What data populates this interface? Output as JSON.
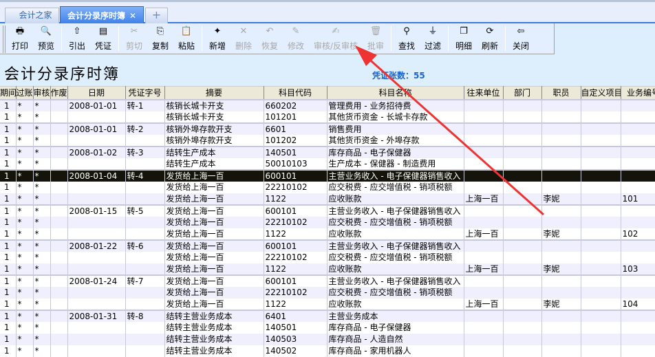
{
  "tabs": [
    {
      "label": "会计之家",
      "active": false
    },
    {
      "label": "会计分录序时簿",
      "active": true,
      "close": "✕"
    },
    {
      "label": "+",
      "active": false
    }
  ],
  "toolbar": {
    "groups": [
      [
        {
          "id": "print",
          "label": "打印",
          "icon": "printer-icon",
          "glyph": "🖶",
          "enabled": true
        },
        {
          "id": "preview",
          "label": "预览",
          "icon": "preview-icon",
          "glyph": "🔍",
          "enabled": true
        }
      ],
      [
        {
          "id": "export",
          "label": "引出",
          "icon": "export-icon",
          "glyph": "⇧",
          "enabled": true
        },
        {
          "id": "voucher",
          "label": "凭证",
          "icon": "voucher-icon",
          "glyph": "▤",
          "enabled": true
        }
      ],
      [
        {
          "id": "cut",
          "label": "剪切",
          "icon": "scissors-icon",
          "glyph": "✂",
          "enabled": false
        },
        {
          "id": "copy",
          "label": "复制",
          "icon": "copy-icon",
          "glyph": "⎘",
          "enabled": true
        },
        {
          "id": "paste",
          "label": "粘贴",
          "icon": "paste-icon",
          "glyph": "📋",
          "enabled": true
        }
      ],
      [
        {
          "id": "new",
          "label": "新增",
          "icon": "new-icon",
          "glyph": "✦",
          "enabled": true
        },
        {
          "id": "delete",
          "label": "删除",
          "icon": "delete-icon",
          "glyph": "✕",
          "enabled": false
        },
        {
          "id": "restore",
          "label": "恢复",
          "icon": "undo-icon",
          "glyph": "↶",
          "enabled": false
        },
        {
          "id": "modify",
          "label": "修改",
          "icon": "edit-icon",
          "glyph": "✎",
          "enabled": false
        },
        {
          "id": "audit",
          "label": "审核/反审核",
          "icon": "audit-icon",
          "glyph": "✍",
          "enabled": false
        },
        {
          "id": "approve",
          "label": "批审",
          "icon": "trash-icon",
          "glyph": "🗑",
          "enabled": false
        }
      ],
      [
        {
          "id": "find",
          "label": "查找",
          "icon": "binoculars-icon",
          "glyph": "⚲",
          "enabled": true
        },
        {
          "id": "filter",
          "label": "过滤",
          "icon": "filter-icon",
          "glyph": "⏚",
          "enabled": true
        }
      ],
      [
        {
          "id": "detail",
          "label": "明细",
          "icon": "detail-icon",
          "glyph": "❐",
          "enabled": true
        },
        {
          "id": "refresh",
          "label": "刷新",
          "icon": "refresh-icon",
          "glyph": "⟳",
          "enabled": true
        }
      ],
      [
        {
          "id": "close",
          "label": "关闭",
          "icon": "exit-door-icon",
          "glyph": "⇦",
          "enabled": true
        }
      ]
    ]
  },
  "page": {
    "title": "会计分录序时簿",
    "count_label": "凭证张数：",
    "count_value": "55"
  },
  "table": {
    "columns": [
      "期间",
      "过账",
      "审核",
      "作废",
      "日期",
      "凭证字号",
      "摘要",
      "科目代码",
      "科目名称",
      "往来单位",
      "部门",
      "职员",
      "自定义项目",
      "业务编号"
    ],
    "rows": [
      {
        "period": "1",
        "posted": "*",
        "audited": "*",
        "voided": "",
        "date": "2008-01-01",
        "voucher": "转-1",
        "summary": "核销长城卡开支",
        "code": "660202",
        "account": "管理费用 - 业务招待费",
        "partner": "",
        "dept": "",
        "staff": "",
        "custom": "",
        "bizno": "",
        "group_start": true
      },
      {
        "period": "1",
        "posted": "*",
        "audited": "*",
        "voided": "",
        "date": "",
        "voucher": "",
        "summary": "核销长城卡开支",
        "code": "101201",
        "account": "其他货币资金 - 长城卡存款",
        "partner": "",
        "dept": "",
        "staff": "",
        "custom": "",
        "bizno": ""
      },
      {
        "period": "1",
        "posted": "*",
        "audited": "*",
        "voided": "",
        "date": "2008-01-01",
        "voucher": "转-2",
        "summary": "核销外埠存款开支",
        "code": "6601",
        "account": "销售费用",
        "partner": "",
        "dept": "",
        "staff": "",
        "custom": "",
        "bizno": "",
        "group_start": true
      },
      {
        "period": "1",
        "posted": "*",
        "audited": "*",
        "voided": "",
        "date": "",
        "voucher": "",
        "summary": "核销外埠存款开支",
        "code": "101202",
        "account": "其他货币资金 - 外埠存款",
        "partner": "",
        "dept": "",
        "staff": "",
        "custom": "",
        "bizno": ""
      },
      {
        "period": "1",
        "posted": "*",
        "audited": "*",
        "voided": "",
        "date": "2008-01-02",
        "voucher": "转-3",
        "summary": "结转生产成本",
        "code": "140501",
        "account": "库存商品 - 电子保健器",
        "partner": "",
        "dept": "",
        "staff": "",
        "custom": "",
        "bizno": "",
        "group_start": true
      },
      {
        "period": "1",
        "posted": "*",
        "audited": "*",
        "voided": "",
        "date": "",
        "voucher": "",
        "summary": "结转生产成本",
        "code": "50010103",
        "account": "生产成本 - 保健器 - 制造费用",
        "partner": "",
        "dept": "",
        "staff": "",
        "custom": "",
        "bizno": ""
      },
      {
        "period": "1",
        "posted": "*",
        "audited": "*",
        "voided": "",
        "date": "2008-01-04",
        "voucher": "转-4",
        "summary": "发货给上海一百",
        "code": "600101",
        "account": "主营业务收入 - 电子保健器销售收入",
        "partner": "",
        "dept": "",
        "staff": "",
        "custom": "",
        "bizno": "",
        "group_start": true,
        "selected": true
      },
      {
        "period": "1",
        "posted": "*",
        "audited": "*",
        "voided": "",
        "date": "",
        "voucher": "",
        "summary": "发货给上海一百",
        "code": "22210102",
        "account": "应交税费 - 应交增值税 - 销项税额",
        "partner": "",
        "dept": "",
        "staff": "",
        "custom": "",
        "bizno": ""
      },
      {
        "period": "1",
        "posted": "*",
        "audited": "*",
        "voided": "",
        "date": "",
        "voucher": "",
        "summary": "发货给上海一百",
        "code": "1122",
        "account": "应收账款",
        "partner": "上海一百",
        "dept": "",
        "staff": "李妮",
        "custom": "",
        "bizno": "101"
      },
      {
        "period": "1",
        "posted": "*",
        "audited": "*",
        "voided": "",
        "date": "2008-01-15",
        "voucher": "转-5",
        "summary": "发货给上海一百",
        "code": "600101",
        "account": "主营业务收入 - 电子保健器销售收入",
        "partner": "",
        "dept": "",
        "staff": "",
        "custom": "",
        "bizno": "",
        "group_start": true
      },
      {
        "period": "1",
        "posted": "*",
        "audited": "*",
        "voided": "",
        "date": "",
        "voucher": "",
        "summary": "发货给上海一百",
        "code": "22210102",
        "account": "应交税费 - 应交增值税 - 销项税额",
        "partner": "",
        "dept": "",
        "staff": "",
        "custom": "",
        "bizno": ""
      },
      {
        "period": "1",
        "posted": "*",
        "audited": "*",
        "voided": "",
        "date": "",
        "voucher": "",
        "summary": "发货给上海一百",
        "code": "1122",
        "account": "应收账款",
        "partner": "上海一百",
        "dept": "",
        "staff": "李妮",
        "custom": "",
        "bizno": "102"
      },
      {
        "period": "1",
        "posted": "*",
        "audited": "*",
        "voided": "",
        "date": "2008-01-22",
        "voucher": "转-6",
        "summary": "发货给上海一百",
        "code": "600101",
        "account": "主营业务收入 - 电子保健器销售收入",
        "partner": "",
        "dept": "",
        "staff": "",
        "custom": "",
        "bizno": "",
        "group_start": true
      },
      {
        "period": "1",
        "posted": "*",
        "audited": "*",
        "voided": "",
        "date": "",
        "voucher": "",
        "summary": "发货给上海一百",
        "code": "22210102",
        "account": "应交税费 - 应交增值税 - 销项税额",
        "partner": "",
        "dept": "",
        "staff": "",
        "custom": "",
        "bizno": ""
      },
      {
        "period": "1",
        "posted": "*",
        "audited": "*",
        "voided": "",
        "date": "",
        "voucher": "",
        "summary": "发货给上海一百",
        "code": "1122",
        "account": "应收账款",
        "partner": "上海一百",
        "dept": "",
        "staff": "李妮",
        "custom": "",
        "bizno": "103"
      },
      {
        "period": "1",
        "posted": "*",
        "audited": "*",
        "voided": "",
        "date": "2008-01-24",
        "voucher": "转-7",
        "summary": "发货给上海一百",
        "code": "600101",
        "account": "主营业务收入 - 电子保健器销售收入",
        "partner": "",
        "dept": "",
        "staff": "",
        "custom": "",
        "bizno": "",
        "group_start": true
      },
      {
        "period": "1",
        "posted": "*",
        "audited": "*",
        "voided": "",
        "date": "",
        "voucher": "",
        "summary": "发货给上海一百",
        "code": "22210102",
        "account": "应交税费 - 应交增值税 - 销项税额",
        "partner": "",
        "dept": "",
        "staff": "",
        "custom": "",
        "bizno": ""
      },
      {
        "period": "1",
        "posted": "*",
        "audited": "*",
        "voided": "",
        "date": "",
        "voucher": "",
        "summary": "发货给上海一百",
        "code": "1122",
        "account": "应收账款",
        "partner": "上海一百",
        "dept": "",
        "staff": "李妮",
        "custom": "",
        "bizno": "104"
      },
      {
        "period": "1",
        "posted": "*",
        "audited": "*",
        "voided": "",
        "date": "2008-01-31",
        "voucher": "转-8",
        "summary": "结转主营业务成本",
        "code": "6401",
        "account": "主营业务成本",
        "partner": "",
        "dept": "",
        "staff": "",
        "custom": "",
        "bizno": "",
        "group_start": true
      },
      {
        "period": "1",
        "posted": "*",
        "audited": "*",
        "voided": "",
        "date": "",
        "voucher": "",
        "summary": "结转主营业务成本",
        "code": "140501",
        "account": "库存商品 - 电子保健器",
        "partner": "",
        "dept": "",
        "staff": "",
        "custom": "",
        "bizno": ""
      },
      {
        "period": "1",
        "posted": "*",
        "audited": "*",
        "voided": "",
        "date": "",
        "voucher": "",
        "summary": "结转主营业务成本",
        "code": "140503",
        "account": "库存商品 - 人造自然",
        "partner": "",
        "dept": "",
        "staff": "",
        "custom": "",
        "bizno": ""
      },
      {
        "period": "1",
        "posted": "*",
        "audited": "*",
        "voided": "",
        "date": "",
        "voucher": "",
        "summary": "结转主营业务成本",
        "code": "140502",
        "account": "库存商品 - 家用机器人",
        "partner": "",
        "dept": "",
        "staff": "",
        "custom": "",
        "bizno": ""
      }
    ]
  },
  "annotation": {
    "color": "#ee3333",
    "points_to": "审核/反审核"
  }
}
